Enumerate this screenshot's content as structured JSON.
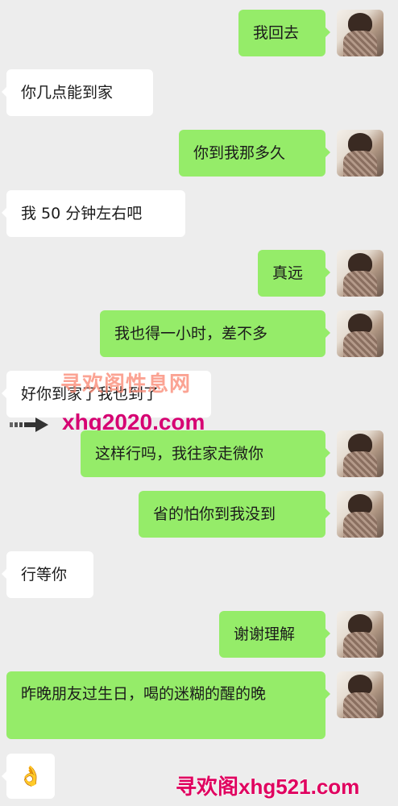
{
  "messages": [
    {
      "side": "right",
      "text": "我回去"
    },
    {
      "side": "left",
      "text": "你几点能到家"
    },
    {
      "side": "right",
      "text": "你到我那多久"
    },
    {
      "side": "left",
      "text": "我 50 分钟左右吧"
    },
    {
      "side": "right",
      "text": "真远"
    },
    {
      "side": "right",
      "text": "我也得一小时，差不多"
    },
    {
      "side": "left",
      "text": "好你到家了我也到了"
    },
    {
      "side": "right",
      "text": "这样行吗，我往家走微你"
    },
    {
      "side": "right",
      "text": "省的怕你到我没到"
    },
    {
      "side": "left",
      "text": "行等你"
    },
    {
      "side": "right",
      "text": "谢谢理解"
    },
    {
      "side": "right",
      "text": "昨晚朋友过生日，喝的迷糊的醒的晚"
    },
    {
      "side": "left",
      "text": "👌"
    }
  ],
  "watermarks": {
    "top": "寻欢阁性息网",
    "url": "xhg2020.com",
    "bottom": "寻欢阁xhg521.com"
  },
  "icons": {
    "avatar": "user-avatar-photo",
    "arrow": "arrow-right-icon"
  }
}
